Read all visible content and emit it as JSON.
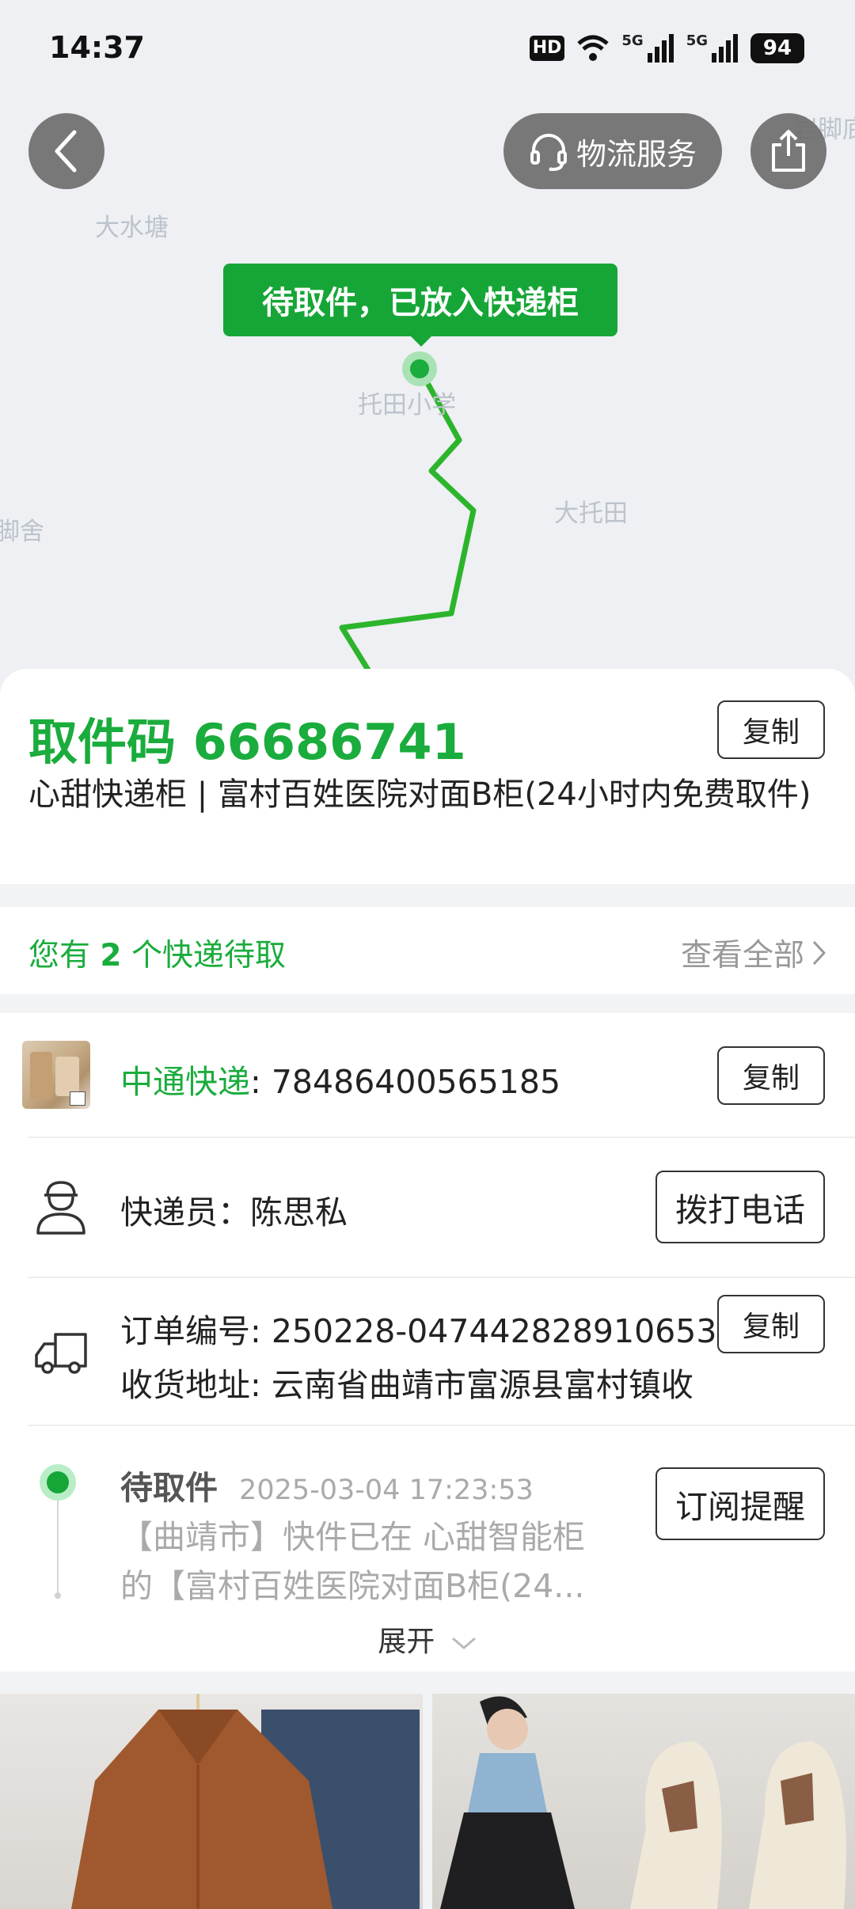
{
  "status_bar": {
    "time": "14:37",
    "hd": "HD",
    "signal_1": "5G",
    "signal_2": "5G",
    "battery": "94"
  },
  "map": {
    "places": [
      "大水塘",
      "托田小学",
      "大托田",
      "脚舍",
      "岩脚底"
    ],
    "route_color": "#2cb52c",
    "status_bubble": "待取件，已放入快递柜"
  },
  "header": {
    "back_icon": "chevron-left-icon",
    "logistics_service": "物流服务",
    "service_icon": "headset-icon",
    "share_icon": "share-icon"
  },
  "pickup": {
    "code_label": "取件码 66686741",
    "copy_label": "复制",
    "location": "心甜快递柜 | 富村百姓医院对面B柜(24小时内免费取件)"
  },
  "pending": {
    "prefix": "您有 ",
    "count": "2",
    "suffix": " 个快递待取",
    "view_all": "查看全部"
  },
  "detail": {
    "carrier": "中通快递",
    "tracking_number": ": 78486400565185",
    "copy_label": "复制",
    "courier_label": "快递员：陈思私",
    "call_label": "拨打电话",
    "order_label": "订单编号: 250228-047442828910653",
    "address_label": "收货地址: 云南省曲靖市富源县富村镇收",
    "timeline": {
      "status": "待取件",
      "time": "2025-03-04 17:23:53",
      "text_line1": "【曲靖市】快件已在 心甜智能柜",
      "text_line2": "的【富村百姓医院对面B柜(24..."
    },
    "subscribe_label": "订阅提醒",
    "expand_label": "展开"
  },
  "colors": {
    "brand_green": "#1aac3c",
    "bubble_green": "#16a637",
    "map_bg": "#eef0f3"
  }
}
